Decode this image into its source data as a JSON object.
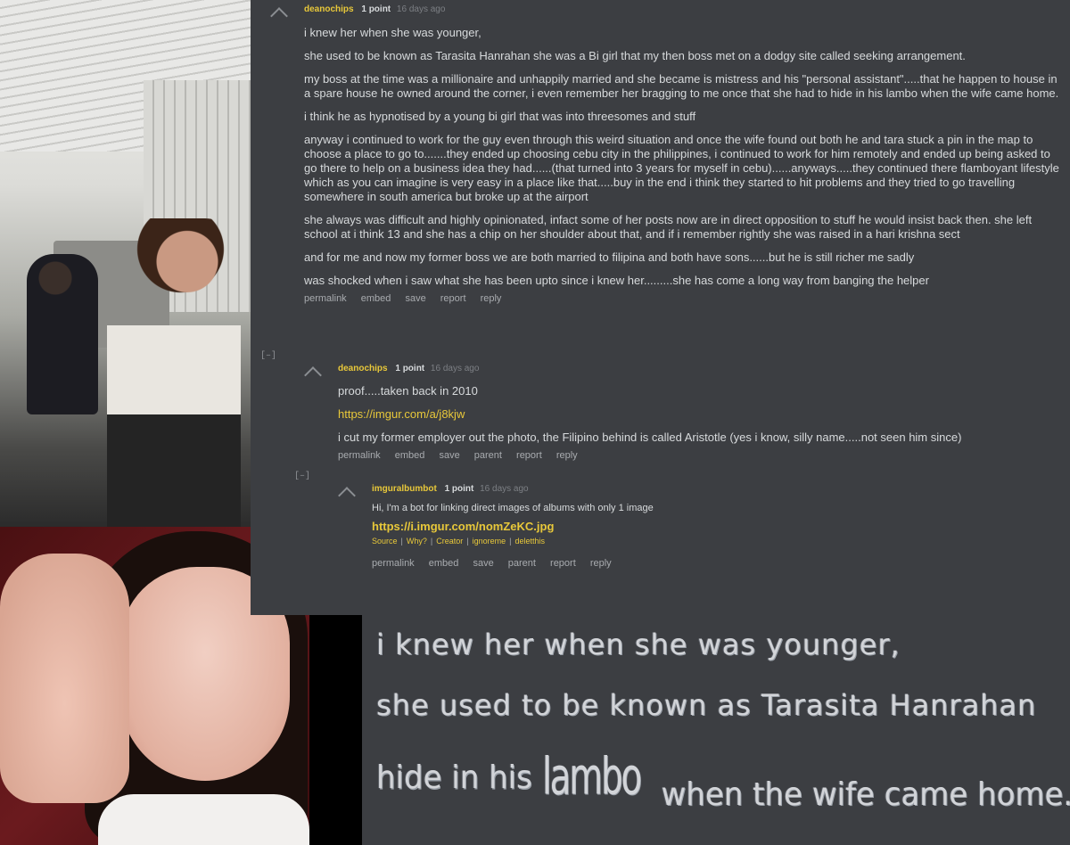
{
  "comments": [
    {
      "author": "deanochips",
      "points": "1 point",
      "age": "16 days ago",
      "paragraphs": [
        "i knew her when she was younger,",
        "she used to be known as Tarasita Hanrahan she was a Bi girl that my then boss met on a dodgy site called seeking arrangement.",
        "my boss at the time was a millionaire and unhappily married and she became is mistress and his \"personal assistant\".....that he happen to house in a spare house he owned around the corner, i even remember her bragging to me once that she had to hide in his lambo when the wife came home.",
        "i think he as hypnotised by a young bi girl that was into threesomes and stuff",
        "anyway i continued to work for the guy even through this weird situation and once the wife found out both he and tara stuck a pin in the map to choose a place to go to.......they ended up choosing cebu city in the philippines, i continued to work for him remotely and ended up being asked to go there to help on a business idea they had......(that turned into 3 years for myself in cebu)......anyways.....they continued there flamboyant lifestyle which as you can imagine is very easy in a place like that.....buy in the end i think they started to hit problems and they tried to go travelling somewhere in south america but broke up at the airport",
        "she always was difficult and highly opinionated, infact some of her posts now are in direct opposition to stuff he would insist back then. she left school at i think 13 and she has a chip on her shoulder about that, and if i remember rightly she was raised in a hari krishna sect",
        "and for me and now my former boss we are both married to filipina and both have sons......but he is still richer me sadly",
        "was shocked when i saw what she has been upto since i knew her.........she has come a long way from banging the helper"
      ],
      "buttons": [
        "permalink",
        "embed",
        "save",
        "report",
        "reply"
      ]
    },
    {
      "author": "deanochips",
      "points": "1 point",
      "age": "16 days ago",
      "paragraphs": [
        "proof.....taken back in 2010",
        "https://imgur.com/a/j8kjw",
        "i cut my former employer out the photo, the Filipino behind is called Aristotle (yes i know, silly name.....not seen him since)"
      ],
      "buttons": [
        "permalink",
        "embed",
        "save",
        "parent",
        "report",
        "reply"
      ]
    },
    {
      "author": "imguralbumbot",
      "points": "1 point",
      "age": "16 days ago",
      "paragraphs": [
        "Hi, I'm a bot for linking direct images of albums with only 1 image"
      ],
      "link": "https://i.imgur.com/nomZeKC.jpg",
      "bot_links": [
        "Source",
        "Why?",
        "Creator",
        "ignoreme",
        "deletthis"
      ],
      "buttons": [
        "permalink",
        "embed",
        "save",
        "parent",
        "report",
        "reply"
      ]
    }
  ],
  "collapse_label": "[–]",
  "zoom": {
    "line1": "i knew her when she was younger,",
    "line2": "she used to be known as Tarasita Hanrahan",
    "line3_before": "hide in his",
    "line3_word": "lambo",
    "line3_after": "when the wife came home."
  },
  "colors": {
    "background": "#3c3e42",
    "author": "#e8c83a",
    "link": "#e8c83a",
    "text": "#d7dadc",
    "muted": "#7c7f84"
  }
}
